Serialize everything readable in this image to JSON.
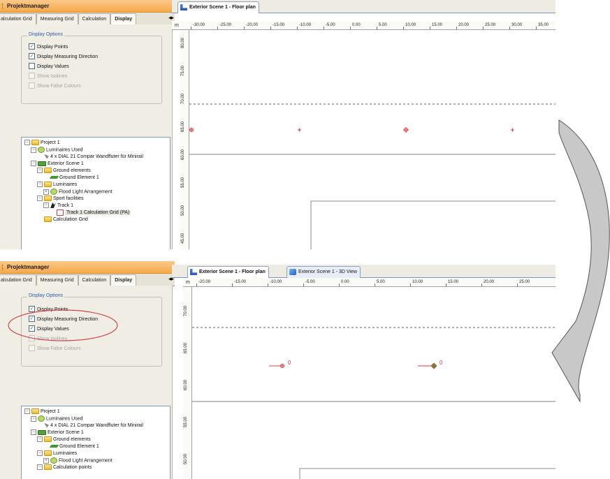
{
  "top": {
    "panel_title": "Projektmanager",
    "tabs": [
      "alculation Grid",
      "Measuring Grid",
      "Calculation",
      "Display"
    ],
    "active_tab": "Display",
    "group_title": "Display Options",
    "options": [
      {
        "label": "Display Points",
        "checked": true,
        "enabled": true
      },
      {
        "label": "Display Measuring Direction",
        "checked": true,
        "enabled": true
      },
      {
        "label": "Display Values",
        "checked": false,
        "enabled": true
      },
      {
        "label": "Show Isolines",
        "checked": false,
        "enabled": false
      },
      {
        "label": "Show False Colours",
        "checked": false,
        "enabled": false
      }
    ],
    "tree": [
      {
        "label": "Project 1",
        "depth": 0,
        "toggle": "-",
        "icon": "folder"
      },
      {
        "label": "Luminaires Used",
        "depth": 1,
        "toggle": "-",
        "icon": "lum"
      },
      {
        "label": "4 x DIAL 21 Compar Wandfluter für Minirail",
        "depth": 2,
        "toggle": "",
        "icon": "lamp"
      },
      {
        "label": "Exterior Scene 1",
        "depth": 1,
        "toggle": "-",
        "icon": "scene"
      },
      {
        "label": "Ground elements",
        "depth": 2,
        "toggle": "-",
        "icon": "folder"
      },
      {
        "label": "Ground Element 1",
        "depth": 3,
        "toggle": "",
        "icon": "ground"
      },
      {
        "label": "Luminaires",
        "depth": 2,
        "toggle": "-",
        "icon": "folder"
      },
      {
        "label": "Flood Light Arrangement",
        "depth": 3,
        "toggle": "+",
        "icon": "lum"
      },
      {
        "label": "Sport facilities",
        "depth": 2,
        "toggle": "-",
        "icon": "folder"
      },
      {
        "label": "Track 1",
        "depth": 3,
        "toggle": "-",
        "icon": "track"
      },
      {
        "label": "Track 1 Calculation Grid (PA)",
        "depth": 4,
        "toggle": "",
        "icon": "grid",
        "selected": true
      },
      {
        "label": "Calculation Grid",
        "depth": 2,
        "toggle": "",
        "icon": "folder"
      }
    ],
    "doc_tabs": [
      {
        "label": "Exterior Scene 1 - Floor plan",
        "icon": "floorplan-icon",
        "active": true
      }
    ],
    "ruler_unit": "m",
    "x_ticks": [
      "-30.00",
      "-25.00",
      "-20.00",
      "-15.00",
      "-10.00",
      "-5.00",
      "0.00",
      "5.00",
      "10.00",
      "15.00",
      "20.00",
      "25.00",
      "30.00",
      "35.00"
    ],
    "y_ticks": [
      "80.00",
      "75.00",
      "70.00",
      "65.00",
      "60.00",
      "55.00",
      "50.00",
      "45.00",
      "40.00"
    ],
    "point_labels": []
  },
  "bottom": {
    "panel_title": "Projektmanager",
    "tabs": [
      "alculation Grid",
      "Measuring Grid",
      "Calculation",
      "Display"
    ],
    "active_tab": "Display",
    "group_title": "Display Options",
    "options": [
      {
        "label": "Display Points",
        "checked": true,
        "enabled": true
      },
      {
        "label": "Display Measuring Direction",
        "checked": true,
        "enabled": true
      },
      {
        "label": "Display Values",
        "checked": true,
        "enabled": true
      },
      {
        "label": "Show Isolines",
        "checked": false,
        "enabled": false
      },
      {
        "label": "Show False Colours",
        "checked": false,
        "enabled": false
      }
    ],
    "tree": [
      {
        "label": "Project 1",
        "depth": 0,
        "toggle": "-",
        "icon": "folder"
      },
      {
        "label": "Luminaires Used",
        "depth": 1,
        "toggle": "-",
        "icon": "lum"
      },
      {
        "label": "4 x DIAL 21 Compar Wandfluter für Minirail",
        "depth": 2,
        "toggle": "",
        "icon": "lamp"
      },
      {
        "label": "Exterior Scene 1",
        "depth": 1,
        "toggle": "-",
        "icon": "scene"
      },
      {
        "label": "Ground elements",
        "depth": 2,
        "toggle": "-",
        "icon": "folder"
      },
      {
        "label": "Ground Element 1",
        "depth": 3,
        "toggle": "",
        "icon": "ground"
      },
      {
        "label": "Luminaires",
        "depth": 2,
        "toggle": "-",
        "icon": "folder"
      },
      {
        "label": "Flood Light Arrangement",
        "depth": 3,
        "toggle": "+",
        "icon": "lum"
      },
      {
        "label": "Calculation points",
        "depth": 2,
        "toggle": "-",
        "icon": "folder"
      }
    ],
    "doc_tabs": [
      {
        "label": "Exterior Scene 1 - Floor plan",
        "icon": "floorplan-icon",
        "active": true
      },
      {
        "label": "Exterior Scene 1 - 3D View",
        "icon": "3d-view-icon",
        "active": false
      }
    ],
    "ruler_unit": "m",
    "x_ticks": [
      "-20.00",
      "-15.00",
      "-10.00",
      "-5.00",
      "0.00",
      "5.00",
      "10.00",
      "15.00",
      "20.00",
      "25.00"
    ],
    "y_ticks": [
      "70.00",
      "65.00",
      "60.00",
      "55.00",
      "50.00"
    ],
    "point_labels": [
      "0",
      "0"
    ]
  },
  "colors": {
    "highlight_ellipse": "#d0464a",
    "arrow_fill": "#c8c8c8",
    "point_red": "#e0373c"
  }
}
